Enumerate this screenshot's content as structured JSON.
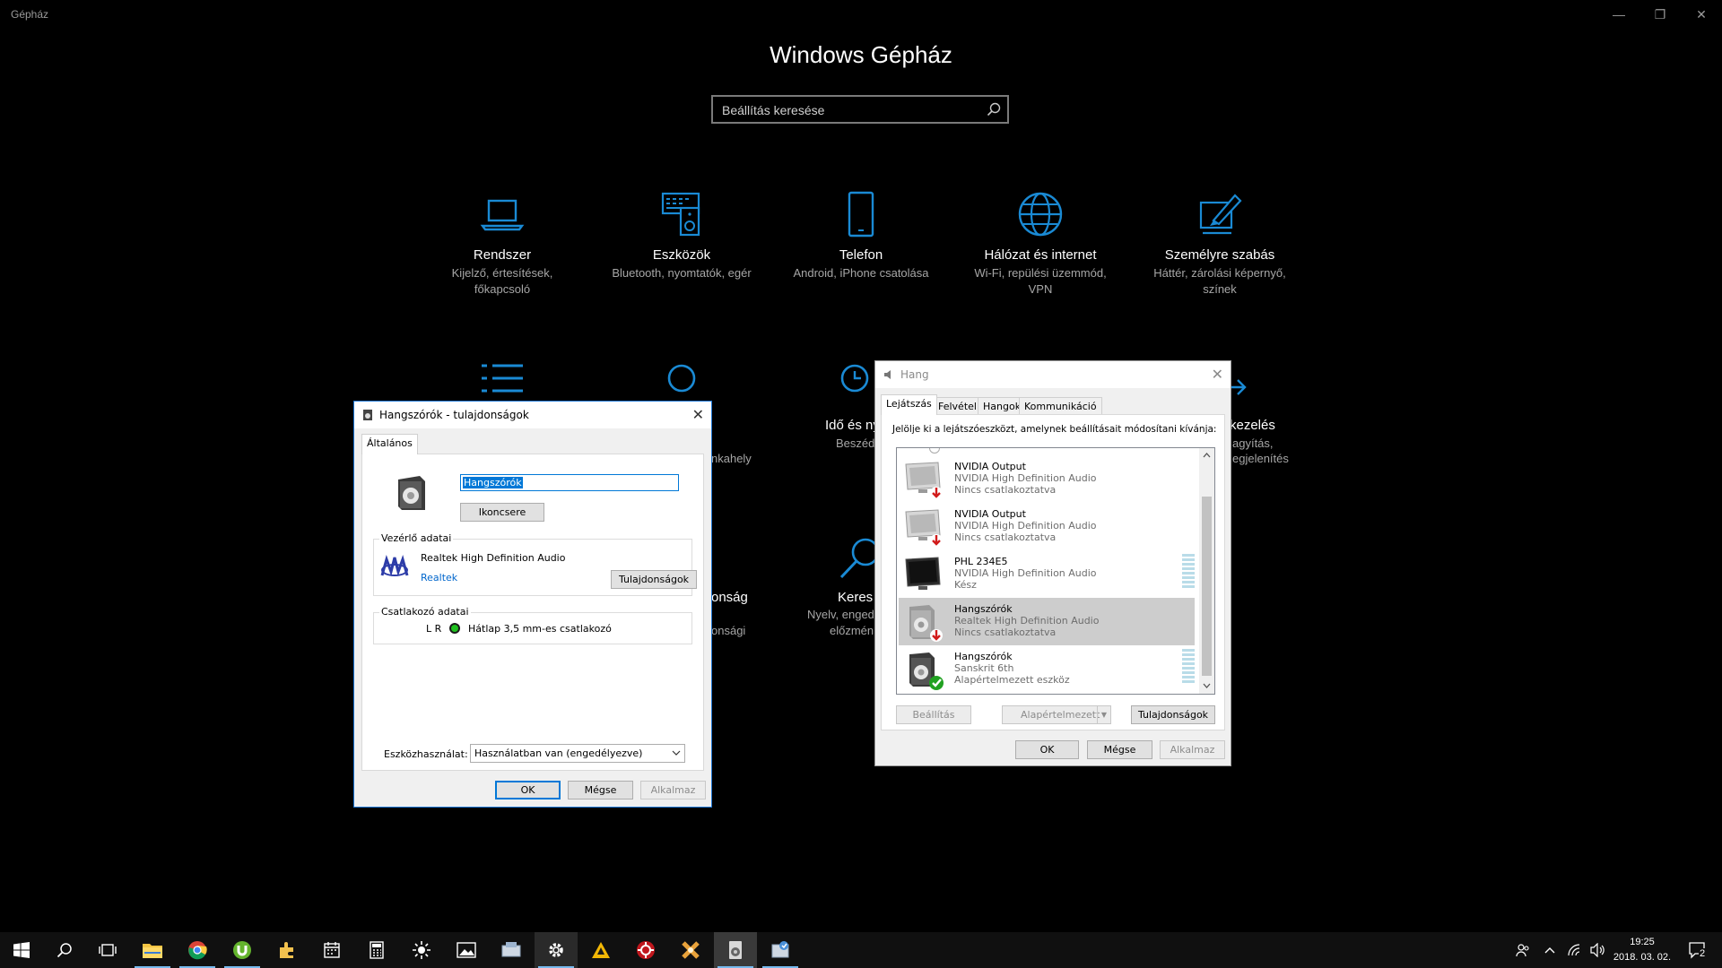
{
  "settings": {
    "app_title": "Gépház",
    "heading": "Windows Gépház",
    "search_placeholder": "Beállítás keresése",
    "tiles": [
      {
        "title": "Rendszer",
        "desc1": "Kijelző, értesítések,",
        "desc2": "főkapcsoló",
        "icon": "laptop-icon"
      },
      {
        "title": "Eszközök",
        "desc1": "Bluetooth, nyomtatók, egér",
        "desc2": "",
        "icon": "devices-icon"
      },
      {
        "title": "Telefon",
        "desc1": "Android, iPhone csatolása",
        "desc2": "",
        "icon": "phone-icon"
      },
      {
        "title": "Hálózat és internet",
        "desc1": "Wi-Fi, repülési üzemmód,",
        "desc2": "VPN",
        "icon": "globe-icon"
      },
      {
        "title": "Személyre szabás",
        "desc1": "Háttér, zárolási képernyő,",
        "desc2": "színek",
        "icon": "paint-icon"
      }
    ],
    "partial": {
      "ido_title": "Idő és ny",
      "ido_desc": "Beszéd, régió",
      "kezeles_title": "kezelés",
      "kezeles_desc1": "agyítás,",
      "kezeles_desc2": "egjelenítés",
      "kereses_title": "Keres",
      "kereses_desc1": "Nyelv, enged",
      "kereses_desc2": "előzmén",
      "fiokok_desc": "nkahely",
      "adatved_title": "onság",
      "adatved_desc": "onsági"
    }
  },
  "props_dialog": {
    "title": "Hangszórók - tulajdonságok",
    "tab": "Általános",
    "name_value": "Hangszórók",
    "change_icon": "Ikoncsere",
    "controller_group": "Vezérlő adatai",
    "controller_name": "Realtek High Definition Audio",
    "vendor_link": "Realtek",
    "properties_btn": "Tulajdonságok",
    "jack_group": "Csatlakozó adatai",
    "jack_lr": "L R",
    "jack_desc": "Hátlap 3,5 mm-es csatlakozó",
    "usage_label": "Eszközhasználat:",
    "usage_value": "Használatban van (engedélyezve)",
    "ok": "OK",
    "cancel": "Mégse",
    "apply": "Alkalmaz"
  },
  "sound_dialog": {
    "title": "Hang",
    "tabs": [
      "Lejátszás",
      "Felvétel",
      "Hangok",
      "Kommunikáció"
    ],
    "instruction": "Jelölje ki a lejátszóeszközt, amelynek beállításait módosítani kívánja:",
    "devices": [
      {
        "name": "NVIDIA Output",
        "driver": "NVIDIA High Definition Audio",
        "status": "Nincs csatlakoztatva"
      },
      {
        "name": "NVIDIA Output",
        "driver": "NVIDIA High Definition Audio",
        "status": "Nincs csatlakoztatva"
      },
      {
        "name": "PHL 234E5",
        "driver": "NVIDIA High Definition Audio",
        "status": "Kész"
      },
      {
        "name": "Hangszórók",
        "driver": "Realtek High Definition Audio",
        "status": "Nincs csatlakoztatva"
      },
      {
        "name": "Hangszórók",
        "driver": "Sanskrit 6th",
        "status": "Alapértelmezett eszköz"
      }
    ],
    "configure": "Beállítás",
    "set_default": "Alapértelmezett",
    "properties": "Tulajdonságok",
    "ok": "OK",
    "cancel": "Mégse",
    "apply": "Alkalmaz"
  },
  "taskbar": {
    "time": "19:25",
    "date": "2018. 03. 02.",
    "notifications": "2"
  },
  "colors": {
    "accent": "#0078d7",
    "settings_icon": "#1a8ad4"
  }
}
